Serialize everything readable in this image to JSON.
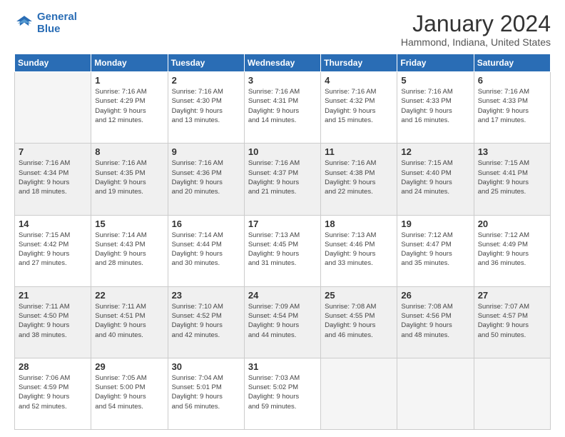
{
  "logo": {
    "line1": "General",
    "line2": "Blue"
  },
  "title": "January 2024",
  "subtitle": "Hammond, Indiana, United States",
  "days_of_week": [
    "Sunday",
    "Monday",
    "Tuesday",
    "Wednesday",
    "Thursday",
    "Friday",
    "Saturday"
  ],
  "weeks": [
    [
      {
        "day": "",
        "info": ""
      },
      {
        "day": "1",
        "info": "Sunrise: 7:16 AM\nSunset: 4:29 PM\nDaylight: 9 hours\nand 12 minutes."
      },
      {
        "day": "2",
        "info": "Sunrise: 7:16 AM\nSunset: 4:30 PM\nDaylight: 9 hours\nand 13 minutes."
      },
      {
        "day": "3",
        "info": "Sunrise: 7:16 AM\nSunset: 4:31 PM\nDaylight: 9 hours\nand 14 minutes."
      },
      {
        "day": "4",
        "info": "Sunrise: 7:16 AM\nSunset: 4:32 PM\nDaylight: 9 hours\nand 15 minutes."
      },
      {
        "day": "5",
        "info": "Sunrise: 7:16 AM\nSunset: 4:33 PM\nDaylight: 9 hours\nand 16 minutes."
      },
      {
        "day": "6",
        "info": "Sunrise: 7:16 AM\nSunset: 4:33 PM\nDaylight: 9 hours\nand 17 minutes."
      }
    ],
    [
      {
        "day": "7",
        "info": "Sunrise: 7:16 AM\nSunset: 4:34 PM\nDaylight: 9 hours\nand 18 minutes."
      },
      {
        "day": "8",
        "info": "Sunrise: 7:16 AM\nSunset: 4:35 PM\nDaylight: 9 hours\nand 19 minutes."
      },
      {
        "day": "9",
        "info": "Sunrise: 7:16 AM\nSunset: 4:36 PM\nDaylight: 9 hours\nand 20 minutes."
      },
      {
        "day": "10",
        "info": "Sunrise: 7:16 AM\nSunset: 4:37 PM\nDaylight: 9 hours\nand 21 minutes."
      },
      {
        "day": "11",
        "info": "Sunrise: 7:16 AM\nSunset: 4:38 PM\nDaylight: 9 hours\nand 22 minutes."
      },
      {
        "day": "12",
        "info": "Sunrise: 7:15 AM\nSunset: 4:40 PM\nDaylight: 9 hours\nand 24 minutes."
      },
      {
        "day": "13",
        "info": "Sunrise: 7:15 AM\nSunset: 4:41 PM\nDaylight: 9 hours\nand 25 minutes."
      }
    ],
    [
      {
        "day": "14",
        "info": "Sunrise: 7:15 AM\nSunset: 4:42 PM\nDaylight: 9 hours\nand 27 minutes."
      },
      {
        "day": "15",
        "info": "Sunrise: 7:14 AM\nSunset: 4:43 PM\nDaylight: 9 hours\nand 28 minutes."
      },
      {
        "day": "16",
        "info": "Sunrise: 7:14 AM\nSunset: 4:44 PM\nDaylight: 9 hours\nand 30 minutes."
      },
      {
        "day": "17",
        "info": "Sunrise: 7:13 AM\nSunset: 4:45 PM\nDaylight: 9 hours\nand 31 minutes."
      },
      {
        "day": "18",
        "info": "Sunrise: 7:13 AM\nSunset: 4:46 PM\nDaylight: 9 hours\nand 33 minutes."
      },
      {
        "day": "19",
        "info": "Sunrise: 7:12 AM\nSunset: 4:47 PM\nDaylight: 9 hours\nand 35 minutes."
      },
      {
        "day": "20",
        "info": "Sunrise: 7:12 AM\nSunset: 4:49 PM\nDaylight: 9 hours\nand 36 minutes."
      }
    ],
    [
      {
        "day": "21",
        "info": "Sunrise: 7:11 AM\nSunset: 4:50 PM\nDaylight: 9 hours\nand 38 minutes."
      },
      {
        "day": "22",
        "info": "Sunrise: 7:11 AM\nSunset: 4:51 PM\nDaylight: 9 hours\nand 40 minutes."
      },
      {
        "day": "23",
        "info": "Sunrise: 7:10 AM\nSunset: 4:52 PM\nDaylight: 9 hours\nand 42 minutes."
      },
      {
        "day": "24",
        "info": "Sunrise: 7:09 AM\nSunset: 4:54 PM\nDaylight: 9 hours\nand 44 minutes."
      },
      {
        "day": "25",
        "info": "Sunrise: 7:08 AM\nSunset: 4:55 PM\nDaylight: 9 hours\nand 46 minutes."
      },
      {
        "day": "26",
        "info": "Sunrise: 7:08 AM\nSunset: 4:56 PM\nDaylight: 9 hours\nand 48 minutes."
      },
      {
        "day": "27",
        "info": "Sunrise: 7:07 AM\nSunset: 4:57 PM\nDaylight: 9 hours\nand 50 minutes."
      }
    ],
    [
      {
        "day": "28",
        "info": "Sunrise: 7:06 AM\nSunset: 4:59 PM\nDaylight: 9 hours\nand 52 minutes."
      },
      {
        "day": "29",
        "info": "Sunrise: 7:05 AM\nSunset: 5:00 PM\nDaylight: 9 hours\nand 54 minutes."
      },
      {
        "day": "30",
        "info": "Sunrise: 7:04 AM\nSunset: 5:01 PM\nDaylight: 9 hours\nand 56 minutes."
      },
      {
        "day": "31",
        "info": "Sunrise: 7:03 AM\nSunset: 5:02 PM\nDaylight: 9 hours\nand 59 minutes."
      },
      {
        "day": "",
        "info": ""
      },
      {
        "day": "",
        "info": ""
      },
      {
        "day": "",
        "info": ""
      }
    ]
  ],
  "row_classes": [
    "row-white",
    "row-shaded",
    "row-white",
    "row-shaded",
    "row-white"
  ]
}
